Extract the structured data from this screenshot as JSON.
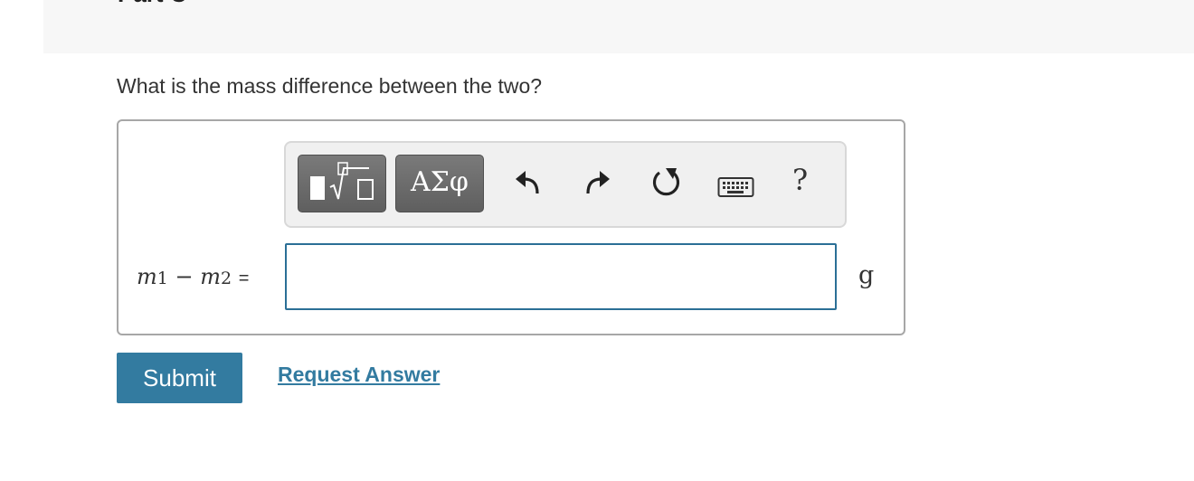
{
  "header": {
    "part_title": "Part C"
  },
  "question": "What is the mass difference between the two?",
  "toolbar": {
    "greek_label": "ΑΣφ",
    "help_label": "?",
    "icons": [
      "templates-icon",
      "undo-icon",
      "redo-icon",
      "reset-icon",
      "keyboard-icon",
      "help-icon"
    ]
  },
  "equation": {
    "var1": "m",
    "sub1": "1",
    "minus": "−",
    "var2": "m",
    "sub2": "2",
    "equals": "="
  },
  "answer": {
    "value": "",
    "placeholder": ""
  },
  "unit": "g",
  "actions": {
    "submit_label": "Submit",
    "request_label": "Request Answer"
  },
  "colors": {
    "accent": "#337ba0",
    "input_border": "#2b6f96",
    "toolbar_button": "#6b6b6b"
  }
}
